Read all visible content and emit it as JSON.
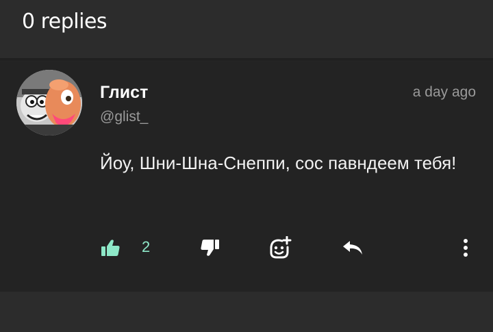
{
  "header": {
    "replies_label": "0 replies"
  },
  "comment": {
    "author_name": "Глист",
    "author_handle": "@glist_",
    "timestamp": "a day ago",
    "text": "Йоу, Шни-Шна-Снеппи, сос павндеем тебя!",
    "likes": "2"
  },
  "icons": {
    "like": "thumbs-up-icon",
    "dislike": "thumbs-down-icon",
    "react": "add-reaction-icon",
    "reply": "reply-icon",
    "more": "more-vertical-icon"
  },
  "colors": {
    "like_active": "#8ee8c8",
    "background": "#2c2c2c",
    "card": "#232323"
  }
}
